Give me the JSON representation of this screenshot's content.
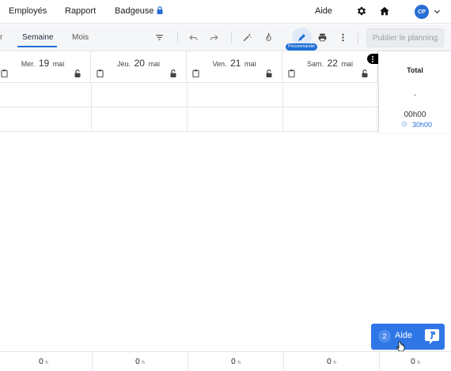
{
  "nav": {
    "items": [
      "Employés",
      "Rapport",
      "Badgeuse"
    ],
    "help_label": "Aide",
    "avatar_initials": "CP",
    "icons": [
      "lock-icon",
      "gear-icon",
      "home-icon",
      "chevron-down-icon"
    ]
  },
  "toolbar": {
    "tab_partial": "r",
    "tab_week": "Semaine",
    "tab_month": "Mois",
    "precommand_badge": "Précommander",
    "publish_label": "Publier le planning",
    "icons": [
      "filter-icon",
      "undo-icon",
      "redo-icon",
      "magic-wand-icon",
      "fire-icon",
      "pencil-icon",
      "printer-icon",
      "more-vertical-icon"
    ]
  },
  "days": [
    {
      "name": "Mer.",
      "num": "19",
      "month": "mai"
    },
    {
      "name": "Jeu.",
      "num": "20",
      "month": "mai"
    },
    {
      "name": "Ven.",
      "num": "21",
      "month": "mai"
    },
    {
      "name": "Sam.",
      "num": "22",
      "month": "mai"
    }
  ],
  "total": {
    "title": "Total",
    "dash": "-",
    "hours": "00h00",
    "sub": "30h00"
  },
  "footer": {
    "values": [
      "0",
      "0",
      "0",
      "0",
      "0"
    ],
    "unit": "h"
  },
  "help_widget": {
    "count": "2",
    "label": "Aide"
  },
  "colors": {
    "accent": "#2f77e6",
    "avatar": "#2a6fd6",
    "border": "#e3e6ea"
  }
}
